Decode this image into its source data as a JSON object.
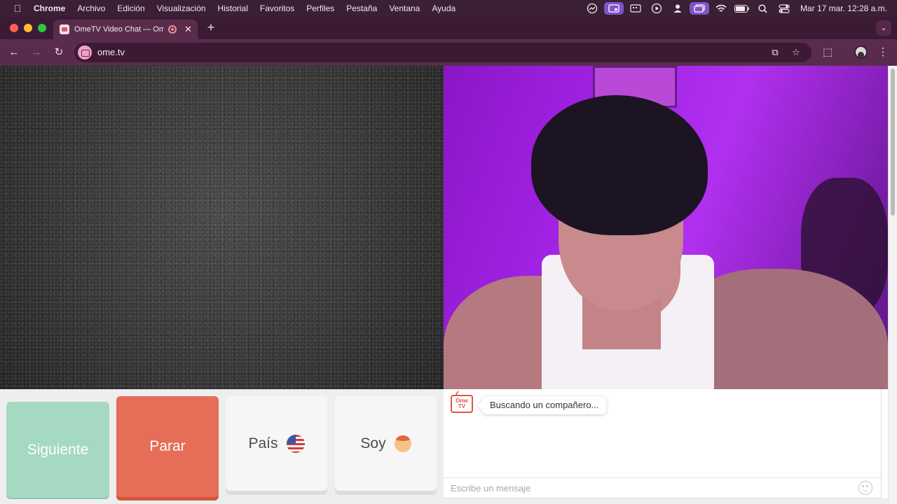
{
  "menubar": {
    "app_name": "Chrome",
    "items": [
      "Archivo",
      "Edición",
      "Visualización",
      "Historial",
      "Favoritos",
      "Perfiles",
      "Pestaña",
      "Ventana",
      "Ayuda"
    ],
    "clock": "Mar 17 mar.  12:28 a.m.",
    "status_icons": [
      "cast-icon",
      "screen-mirror-icon",
      "keyboard-icon",
      "play-icon",
      "user-icon",
      "window-icon",
      "wifi-icon",
      "battery-icon",
      "search-icon",
      "control-center-icon"
    ]
  },
  "tabs": [
    {
      "title": "OmeTV Video Chat — Omegle",
      "recording": true,
      "close_label": "✕"
    }
  ],
  "tabstrip": {
    "new_tab_label": "+",
    "tab_search_label": "⌄"
  },
  "toolbar": {
    "back_label": "←",
    "forward_label": "→",
    "reload_label": "↻",
    "url": "ome.tv",
    "install_label": "⧉",
    "bookmark_label": "☆",
    "extensions_label": "⬚",
    "menu_label": "⋮"
  },
  "controls": {
    "next_label": "Siguiente",
    "stop_label": "Parar",
    "country_label": "País",
    "gender_label": "Soy",
    "country_flag": "us-flag-icon",
    "gender_icon": "boy-icon"
  },
  "chat": {
    "logo_text": "Ome TV",
    "messages": [
      {
        "text": "Buscando un compañero..."
      }
    ],
    "input_placeholder": "Escribe un mensaje"
  },
  "colors": {
    "next_button": "#a6d9c1",
    "stop_button": "#e66d57",
    "chrome_frame": "#5a2c4c",
    "video_right_bg": "#a524e8"
  }
}
